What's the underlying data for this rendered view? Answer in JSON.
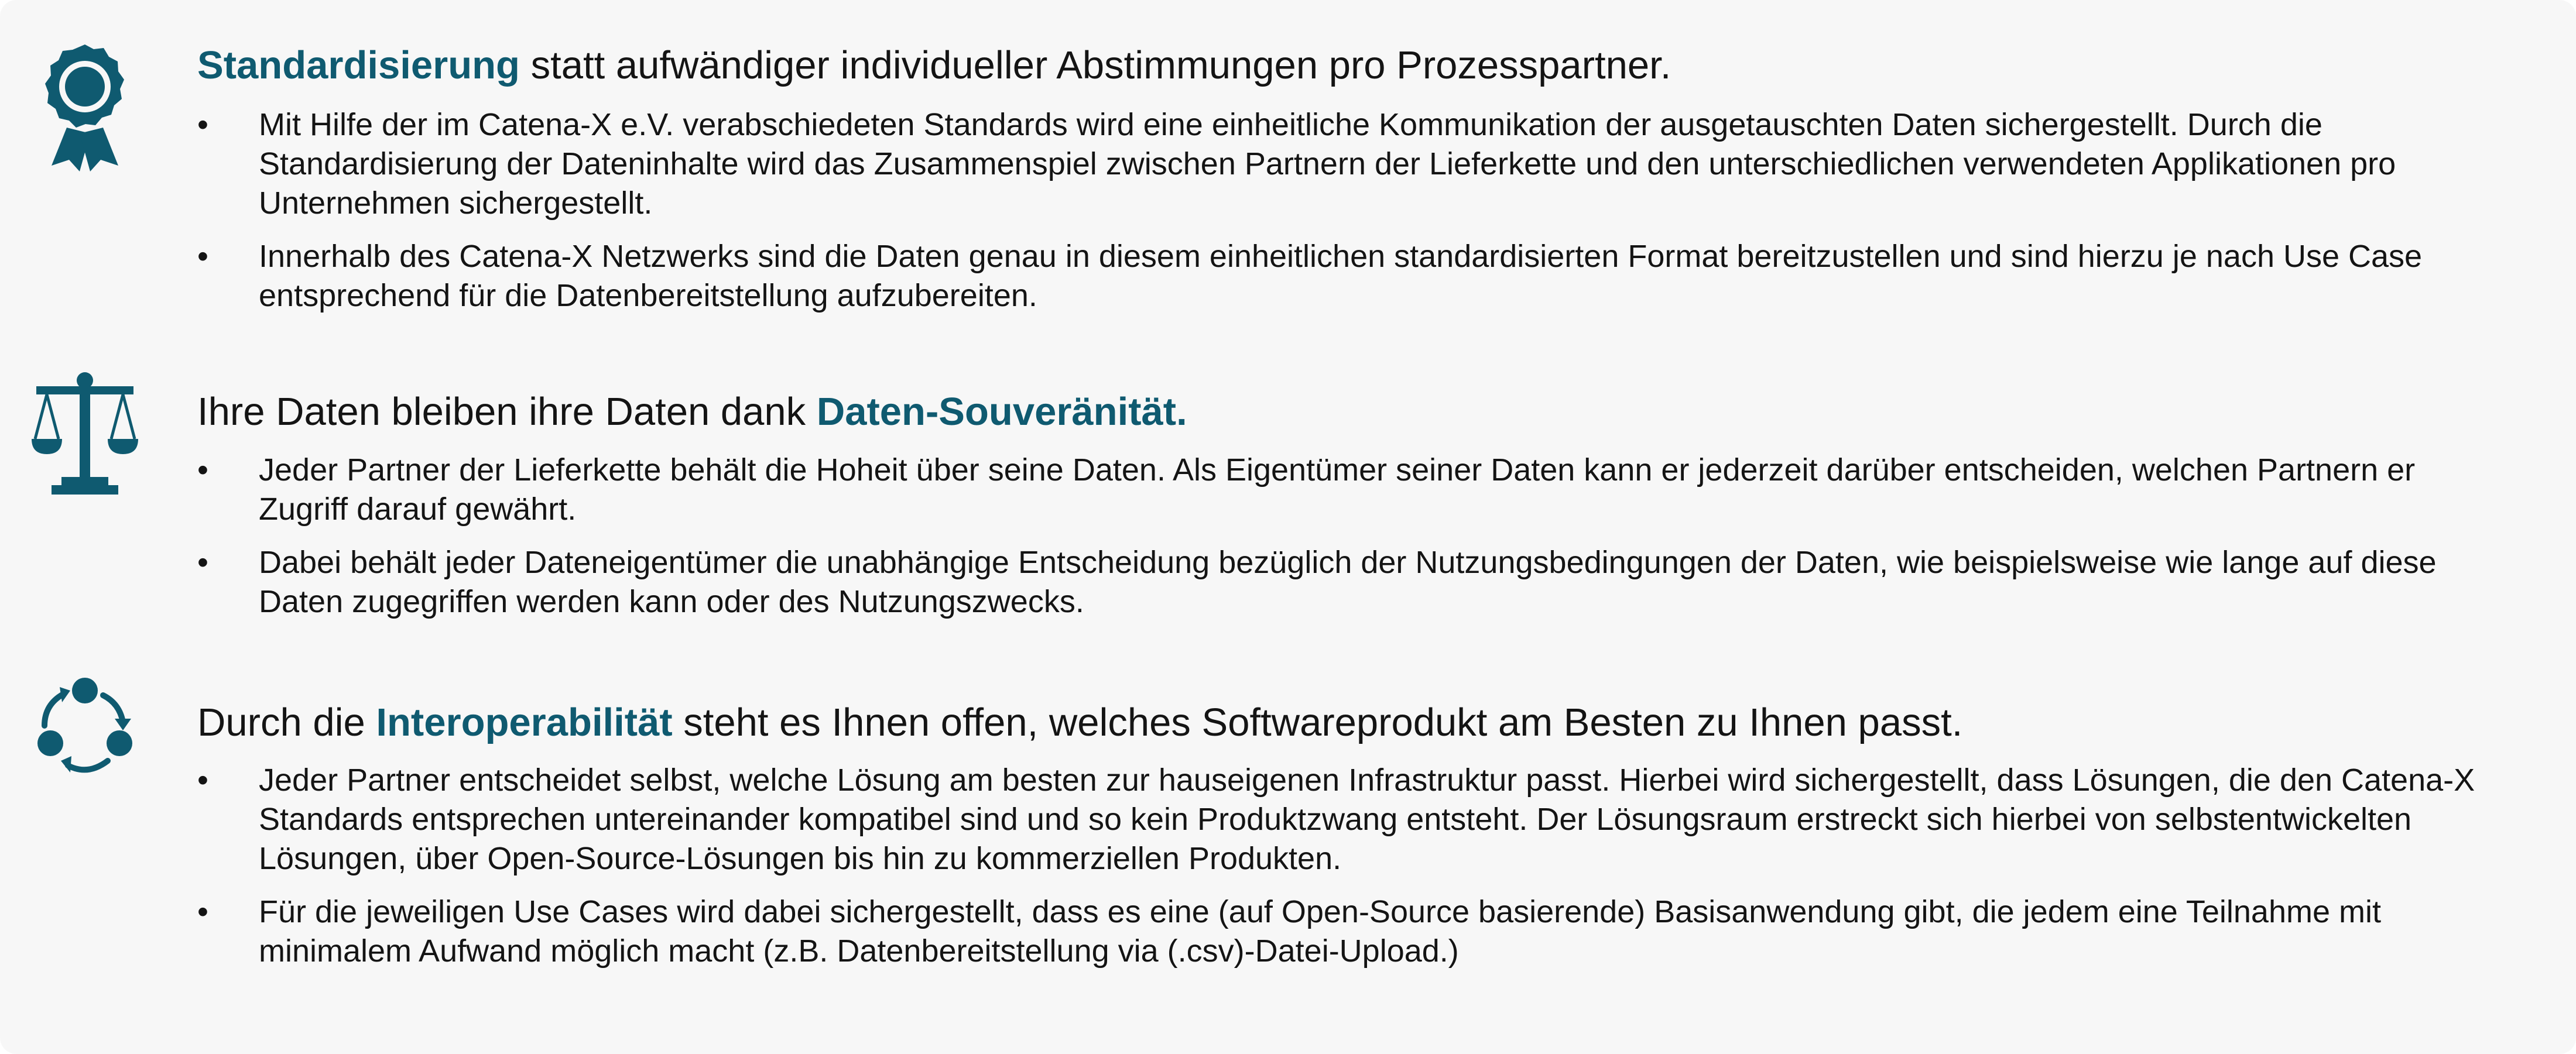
{
  "sections": [
    {
      "icon": "award-rosette-icon",
      "heading_before": "",
      "heading_highlight": "Standardisierung",
      "heading_after": " statt aufwändiger individueller Abstimmungen pro Prozesspartner.",
      "bullets": [
        "Mit Hilfe der im Catena-X e.V. verabschiedeten Standards wird eine einheitliche Kommunikation der ausgetauschten Daten sichergestellt. Durch die Standardisierung der Dateninhalte wird das Zusammenspiel zwischen Partnern der Lieferkette und den unterschiedlichen verwendeten Applikationen pro Unternehmen sichergestellt.",
        "Innerhalb des Catena-X Netzwerks sind die Daten genau in diesem einheitlichen standardisierten Format bereitzustellen und sind hierzu je nach Use Case entsprechend für die Datenbereitstellung aufzubereiten."
      ]
    },
    {
      "icon": "scales-of-justice-icon",
      "heading_before": "Ihre Daten bleiben ihre Daten dank ",
      "heading_highlight": "Daten-Souveränität.",
      "heading_after": "",
      "bullets": [
        "Jeder Partner der Lieferkette behält die Hoheit über seine Daten. Als Eigentümer seiner Daten kann er jederzeit darüber entscheiden, welchen Partnern er Zugriff darauf gewährt.",
        "Dabei behält jeder Dateneigentümer die unabhängige Entscheidung bezüglich der Nutzungsbedingungen der Daten, wie beispielsweise wie lange auf diese Daten zugegriffen werden kann oder des Nutzungszwecks."
      ]
    },
    {
      "icon": "cycle-arrows-icon",
      "heading_before": "Durch die ",
      "heading_highlight": "Interoperabilität",
      "heading_after": " steht es Ihnen offen, welches Softwareprodukt am Besten zu Ihnen passt.",
      "bullets": [
        "Jeder Partner entscheidet selbst, welche Lösung am besten zur hauseigenen Infrastruktur passt. Hierbei wird sichergestellt, dass Lösungen, die den Catena-X Standards entsprechen untereinander kompatibel sind und so kein Produktzwang entsteht. Der Lösungsraum erstreckt sich hierbei von selbstentwickelten Lösungen, über Open-Source-Lösungen bis hin zu kommerziellen Produkten.",
        "Für die jeweiligen Use Cases wird dabei sichergestellt, dass es eine (auf Open-Source basierende) Basisanwendung gibt, die jedem eine Teilnahme mit minimalem Aufwand möglich macht (z.B. Datenbereitstellung via (.csv)-Datei-Upload.)"
      ]
    }
  ],
  "bullet_glyph": "•",
  "colors": {
    "accent": "#0f5a70",
    "text": "#141414",
    "background": "#f7f7f7"
  }
}
